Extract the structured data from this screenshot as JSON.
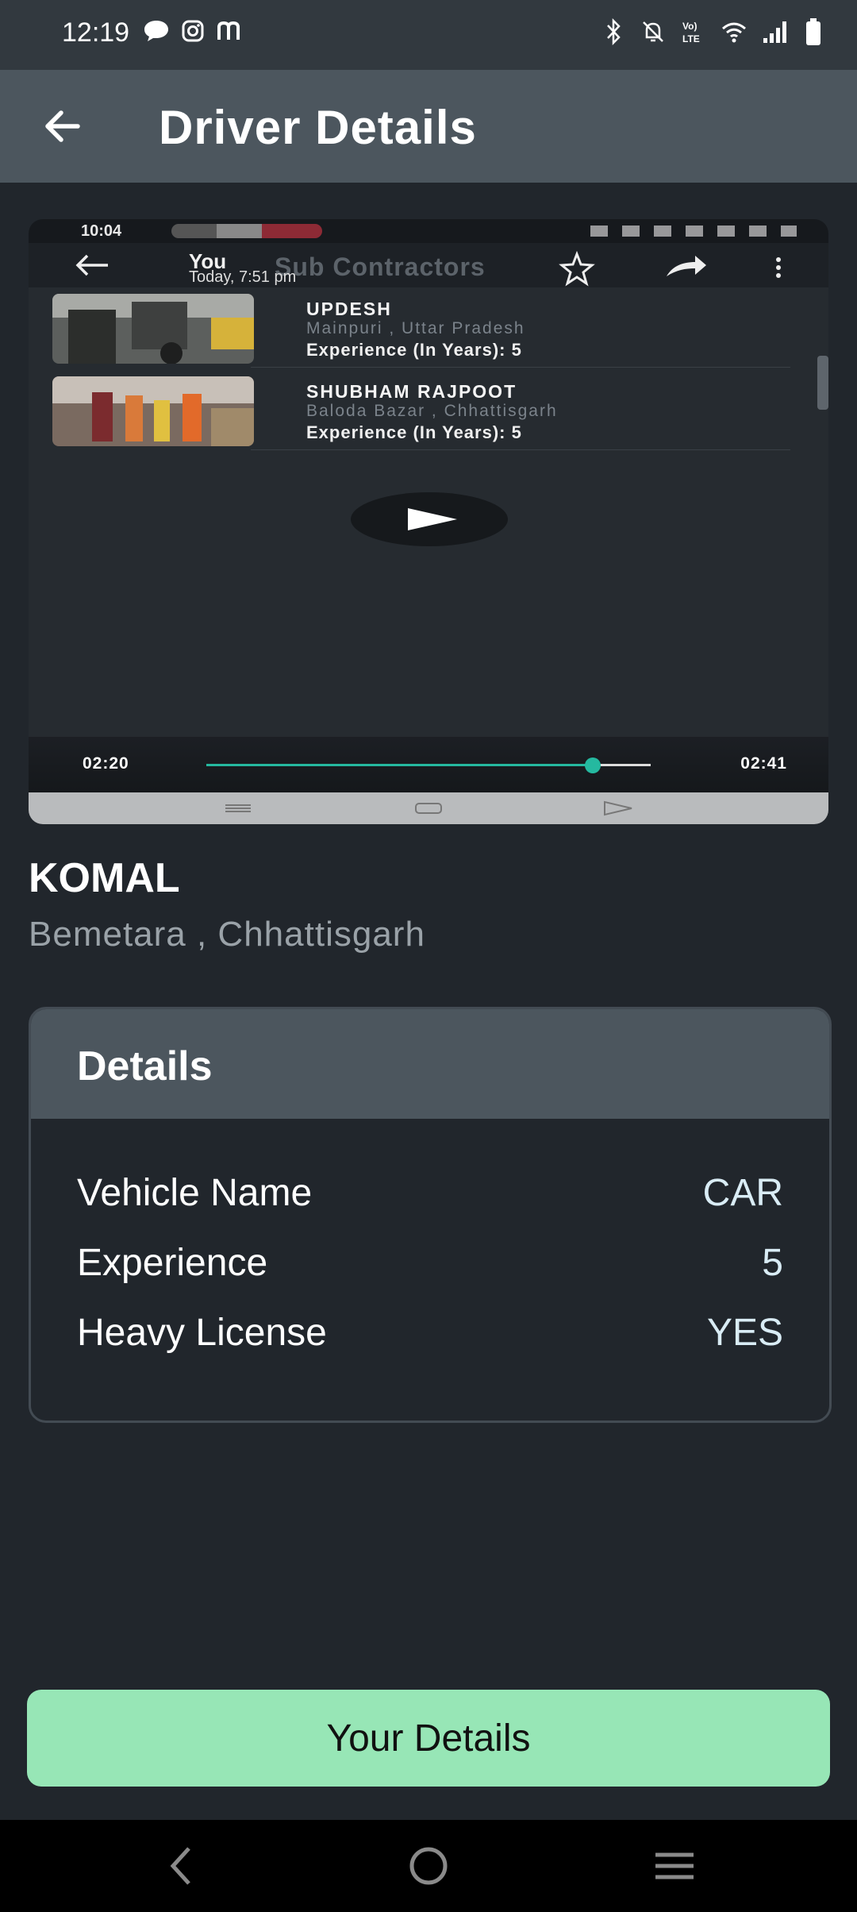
{
  "status_bar": {
    "time": "12:19",
    "left_icons": [
      "chat-bubble-icon",
      "instagram-icon",
      "m-app-icon"
    ],
    "right_icons": [
      "bluetooth-icon",
      "bell-muted-icon",
      "volte-icon",
      "wifi-icon",
      "signal-icon",
      "battery-icon"
    ]
  },
  "appbar": {
    "title": "Driver Details",
    "back_icon": "arrow-left-icon"
  },
  "video": {
    "status_time": "10:04",
    "chat_header": {
      "name": "You",
      "time": "Today, 7:51 pm",
      "title_behind": "Sub Contractors"
    },
    "rows": [
      {
        "name": "UPDESH",
        "location": "Mainpuri , Uttar Pradesh",
        "experience": "Experience (In Years): 5"
      },
      {
        "name": "SHUBHAM RAJPOOT",
        "location": "Baloda Bazar , Chhattisgarh",
        "experience": "Experience (In Years): 5"
      }
    ],
    "elapsed": "02:20",
    "duration": "02:41",
    "progress": 0.87
  },
  "driver": {
    "name": "KOMAL",
    "location": "Bemetara , Chhattisgarh"
  },
  "details": {
    "heading": "Details",
    "rows": [
      {
        "label": "Vehicle Name",
        "value": "CAR"
      },
      {
        "label": "Experience",
        "value": "5"
      },
      {
        "label": "Heavy License",
        "value": "YES"
      }
    ]
  },
  "button": {
    "label": "Your Details"
  },
  "colors": {
    "button_bg": "#97e6b6",
    "appbar_bg": "#4c565e",
    "page_bg": "#21262c",
    "accent_progress": "#25b9a0"
  }
}
